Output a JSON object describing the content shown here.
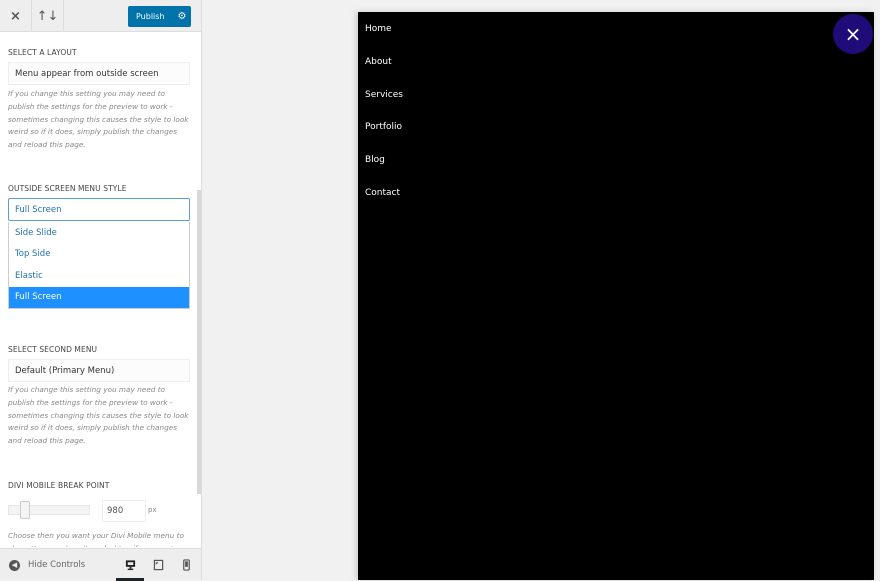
{
  "topbar": {
    "close_icon": "×",
    "sort_icon": "↑↓",
    "publish_label": "Publish",
    "gear_icon": "⚙"
  },
  "sections": {
    "layout": {
      "title": "SELECT A LAYOUT",
      "value": "Menu appear from outside screen",
      "description": "If you change this setting you may need to publish the settings for the preview to work - sometimes changing this causes the style to look weird so if it does, simply publish the changes and reload this page."
    },
    "menu_style": {
      "title": "OUTSIDE SCREEN MENU STYLE",
      "value": "Full Screen",
      "options": [
        "Side Slide",
        "Top Side",
        "Elastic",
        "Full Screen"
      ],
      "selected_index": 3
    },
    "second_menu": {
      "title": "SELECT SECOND MENU",
      "value": "Default (Primary Menu)",
      "description": "If you change this setting you may need to publish the settings for the preview to work - sometimes changing this causes the style to look weird so if it does, simply publish the changes and reload this page."
    },
    "breakpoint": {
      "title": "DIVI MOBILE BREAK POINT",
      "value": "980",
      "unit": "px",
      "description": "Choose then you want your Divi Mobile menu to show. You can show it on desktop if you want"
    }
  },
  "bottombar": {
    "hide_controls_label": "Hide Controls",
    "devices": [
      "desktop",
      "tablet",
      "mobile"
    ],
    "active_device": "desktop"
  },
  "preview": {
    "menu_items": [
      "Home",
      "About",
      "Services",
      "Portfolio",
      "Blog",
      "Contact"
    ],
    "close_icon": "×",
    "close_color": "#1f0c78"
  },
  "colors": {
    "accent": "#0073aa",
    "selected_option": "#1e90ff",
    "preview_bg": "#000000"
  }
}
